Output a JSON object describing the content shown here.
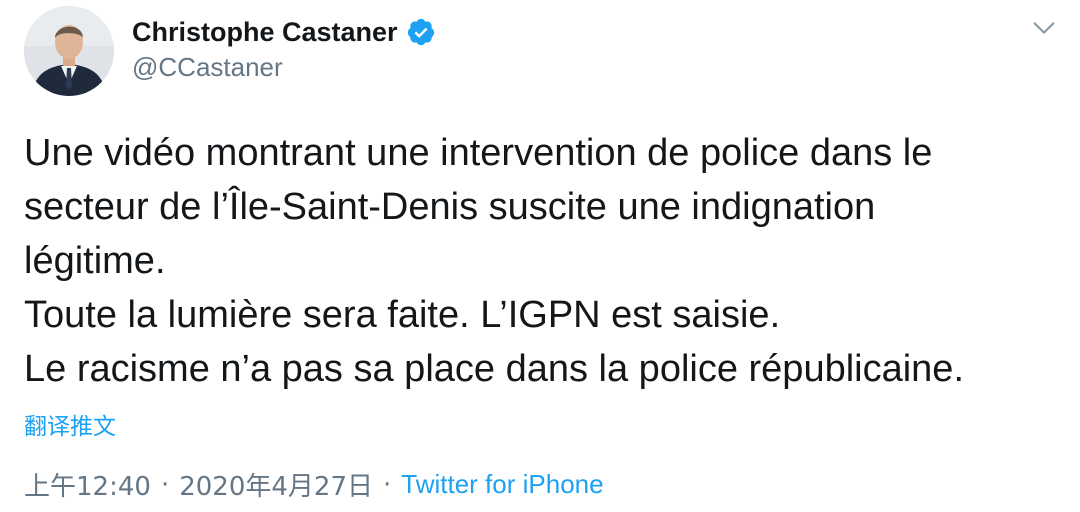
{
  "author": {
    "display_name": "Christophe Castaner",
    "handle": "@CCastaner",
    "verified_icon": "verified-badge-icon"
  },
  "menu": {
    "icon": "chevron-down-icon"
  },
  "tweet": {
    "lines": [
      "Une vidéo montrant une intervention de police dans le",
      "secteur de l’Île-Saint-Denis suscite une indignation",
      "légitime.",
      "Toute la lumière sera faite. L’IGPN est saisie.",
      "Le racisme n’a pas sa place dans la police républicaine."
    ],
    "translate_label": "翻译推文"
  },
  "meta": {
    "time": "上午12:40",
    "separator": "·",
    "date": "2020年4月27日",
    "source": "Twitter for iPhone"
  },
  "colors": {
    "accent": "#1da1f2",
    "text": "#14171a",
    "secondary": "#657786"
  }
}
